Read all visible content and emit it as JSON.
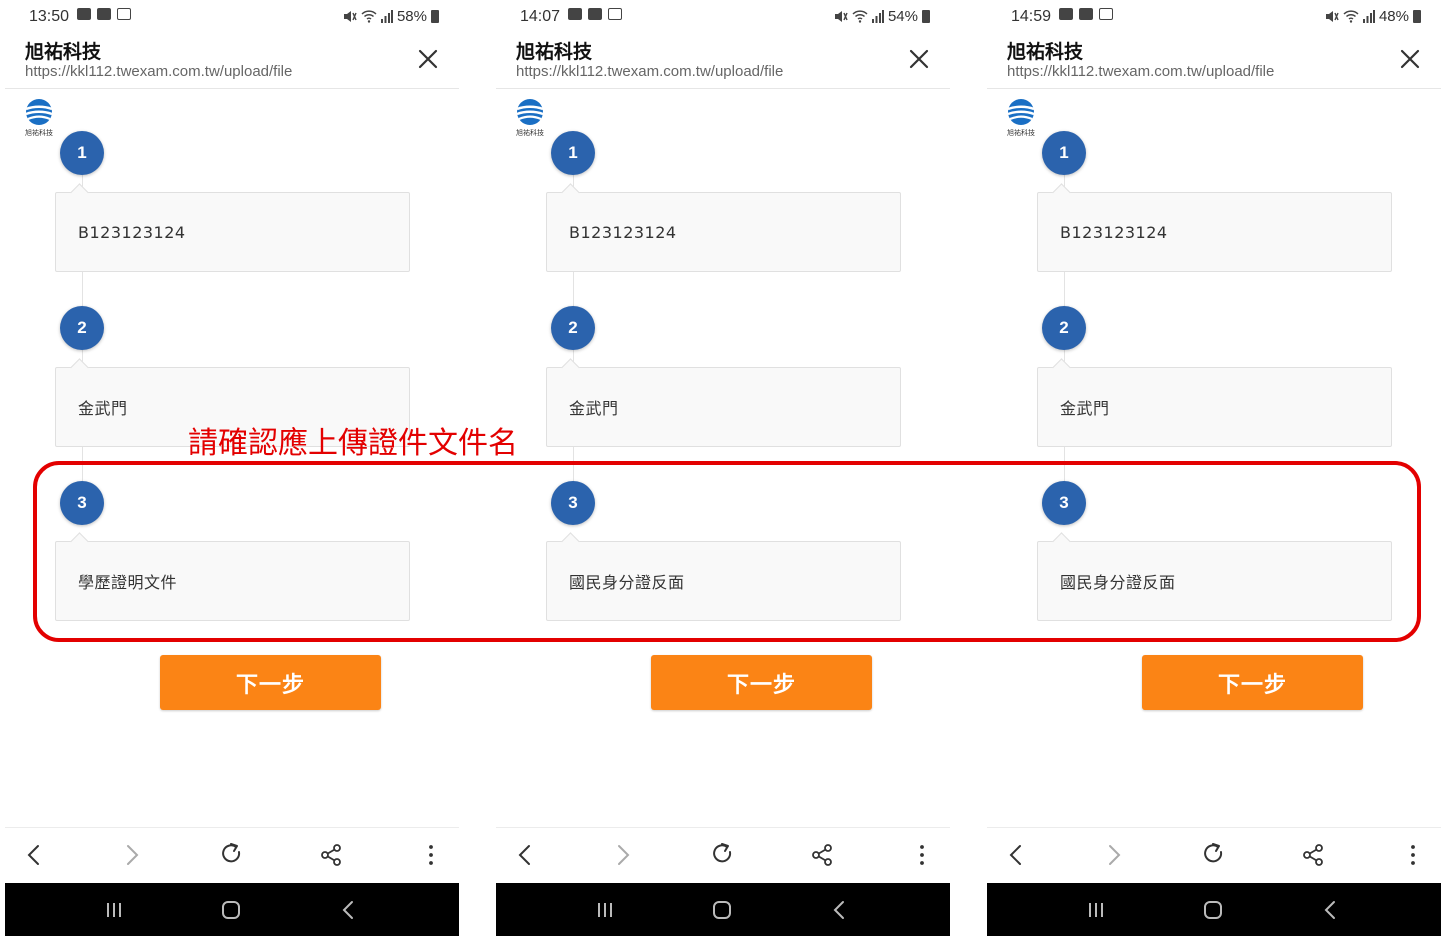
{
  "phones": [
    {
      "status": {
        "time": "13:50",
        "battery": "58%"
      },
      "site": {
        "title": "旭祐科技",
        "url": "https://kkl112.twexam.com.tw/upload/file"
      },
      "logo_caption": "旭祐科技",
      "steps": [
        {
          "num": "1",
          "value": "B123123124"
        },
        {
          "num": "2",
          "value": "金武門"
        },
        {
          "num": "3",
          "value": "學歷證明文件"
        }
      ],
      "next_label": "下一步"
    },
    {
      "status": {
        "time": "14:07",
        "battery": "54%"
      },
      "site": {
        "title": "旭祐科技",
        "url": "https://kkl112.twexam.com.tw/upload/file"
      },
      "logo_caption": "旭祐科技",
      "steps": [
        {
          "num": "1",
          "value": "B123123124"
        },
        {
          "num": "2",
          "value": "金武門"
        },
        {
          "num": "3",
          "value": "國民身分證反面"
        }
      ],
      "next_label": "下一步"
    },
    {
      "status": {
        "time": "14:59",
        "battery": "48%"
      },
      "site": {
        "title": "旭祐科技",
        "url": "https://kkl112.twexam.com.tw/upload/file"
      },
      "logo_caption": "旭祐科技",
      "steps": [
        {
          "num": "1",
          "value": "B123123124"
        },
        {
          "num": "2",
          "value": "金武門"
        },
        {
          "num": "3",
          "value": "國民身分證反面"
        }
      ],
      "next_label": "下一步"
    }
  ],
  "annotation": {
    "text": "請確認應上傳證件文件名",
    "color": "#e30000"
  },
  "colors": {
    "step_badge": "#2b63ad",
    "next_button": "#fb8415"
  },
  "icons": {
    "close": "close-icon",
    "back": "back-arrow-icon",
    "forward": "forward-arrow-icon",
    "reload": "reload-icon",
    "share": "share-icon",
    "more": "more-vert-icon",
    "logo": "company-logo-icon"
  }
}
